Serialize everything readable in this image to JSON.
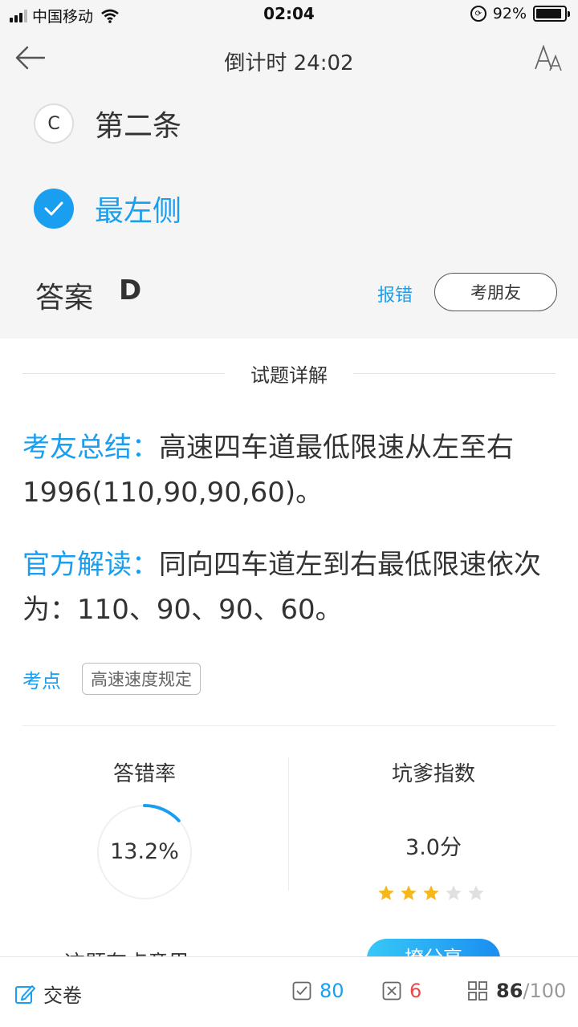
{
  "status_bar": {
    "carrier": "中国移动",
    "time": "02:04",
    "battery": "92%",
    "battery_level": 0.92
  },
  "nav": {
    "title": "倒计时 24:02"
  },
  "options": {
    "c": {
      "letter": "C",
      "text": "第二条"
    },
    "d": {
      "text": "最左侧",
      "selected": true
    }
  },
  "answer": {
    "label": "答案",
    "value": "D",
    "report": "报错",
    "ask_friend": "考朋友"
  },
  "explanation": {
    "section_title": "试题详解",
    "friend_summary_tag": "考友总结：",
    "friend_summary_text": "高速四车道最低限速从左至右1996(110,90,90,60)。",
    "official_tag": "官方解读：",
    "official_text": "同向四车道左到右最低限速依次为：110、90、90、60。",
    "point_label": "考点",
    "point_chip": "高速速度规定"
  },
  "stats": {
    "error_rate_title": "答错率",
    "error_rate": "13.2%",
    "error_rate_value": 0.132,
    "trap_title": "坑爹指数",
    "trap_score": "3.0分",
    "stars_filled": 3,
    "stars_total": 5
  },
  "partial": {
    "text": "这题有点意思",
    "button": "撩分享"
  },
  "bottom_bar": {
    "submit": "交卷",
    "correct_count": "80",
    "wrong_count": "6",
    "current": "86",
    "total": "/100"
  },
  "colors": {
    "accent": "#1a9ff0",
    "wrong": "#f04848",
    "star_on": "#f5b81c",
    "star_off": "#e0e0e0"
  }
}
